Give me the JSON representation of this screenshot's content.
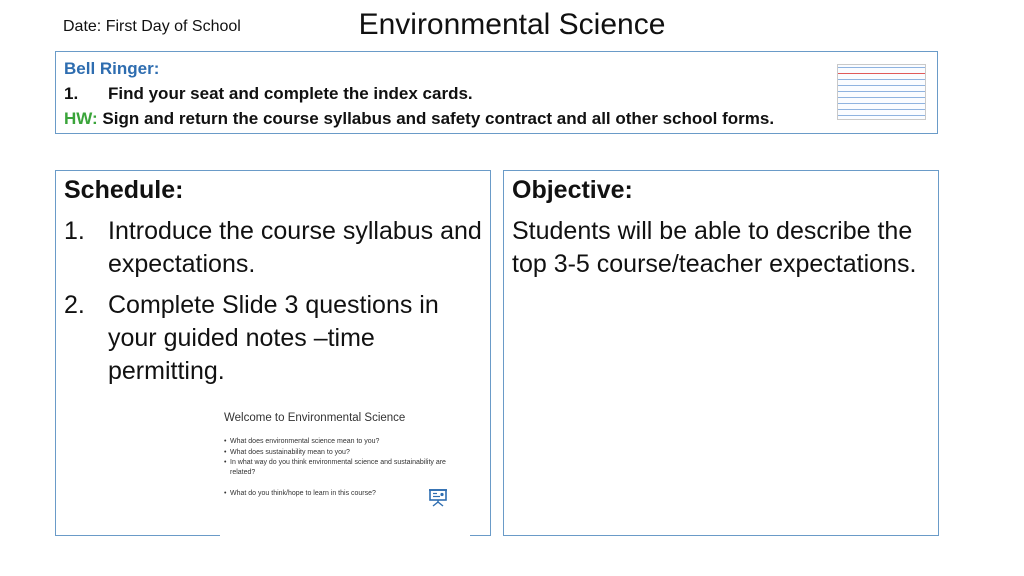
{
  "header": {
    "date": "Date:  First Day of School",
    "title": "Environmental Science"
  },
  "bell_ringer": {
    "heading": "Bell Ringer:",
    "items": [
      {
        "number": "1.",
        "text": "Find your seat and complete the index  cards."
      }
    ],
    "hw_label": "HW:",
    "hw_text": " Sign and return the course syllabus and safety contract and all other school forms.",
    "image": "index-card-icon"
  },
  "schedule": {
    "heading": "Schedule:",
    "items": [
      {
        "number": "1.",
        "text": "Introduce the course syllabus and expectations."
      },
      {
        "number": "2.",
        "text": "Complete Slide 3 questions in your guided notes –time permitting."
      }
    ]
  },
  "objective": {
    "heading": "Objective:",
    "text": "Students will be able to describe the  top 3-5 course/teacher expectations."
  },
  "slide_thumbnail": {
    "title": "Welcome to Environmental Science",
    "bullets": [
      "What does environmental science mean to you?",
      "What does sustainability mean to you?",
      "In what way do you think environmental science and sustainability are related?",
      "What do you think/hope to learn in this course?"
    ],
    "icon": "presentation-icon"
  },
  "colors": {
    "accent_blue": "#2e6db0",
    "hw_green": "#3aa43a",
    "border": "#6a9bc8"
  }
}
